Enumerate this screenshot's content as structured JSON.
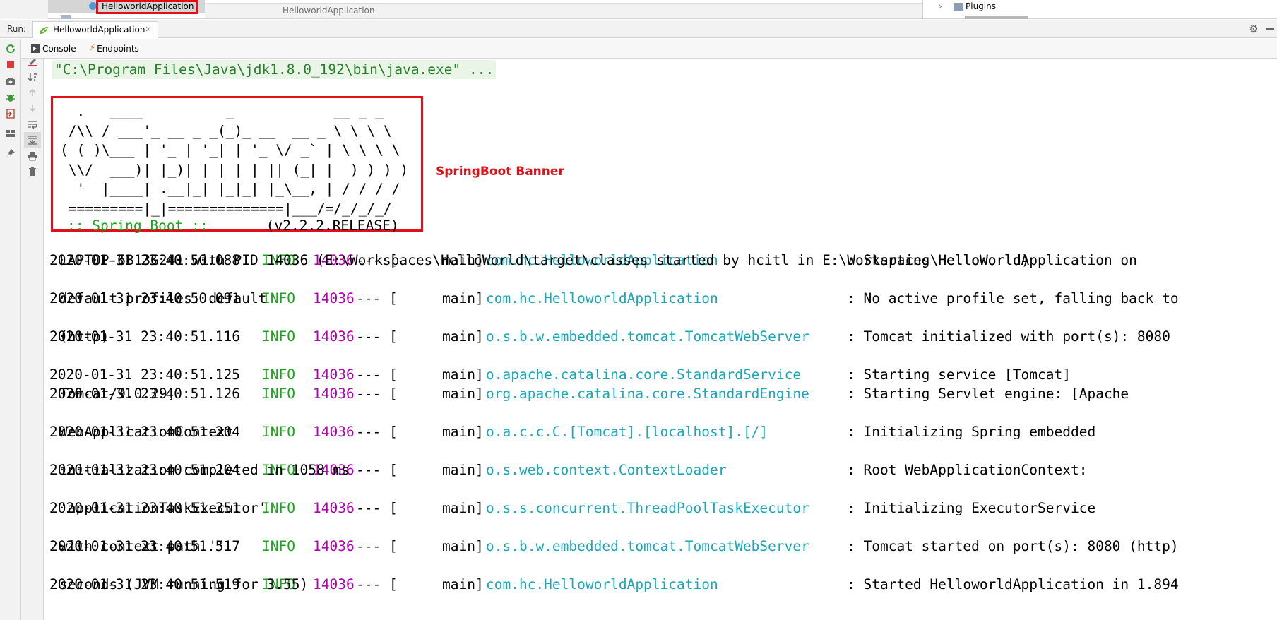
{
  "top_strip": {
    "tree_selected_item": "HelloworldApplication",
    "editor_tab_title": "HelloworldApplication",
    "right_panel_item": "Plugins"
  },
  "run_panel": {
    "run_label": "Run:",
    "run_tab": "HelloworldApplication",
    "console_tab": "Console",
    "endpoints_tab": "Endpoints"
  },
  "console": {
    "command_line": "\"C:\\Program Files\\Java\\jdk1.8.0_192\\bin\\java.exe\" ...",
    "banner_art": "  .   ____          _            __ _ _\n /\\\\ / ___'_ __ _ _(_)_ __  __ _ \\ \\ \\ \\\n( ( )\\___ | '_ | '_| | '_ \\/ _` | \\ \\ \\ \\\n \\\\/  ___)| |_)| | | | | || (_| |  ) ) ) )\n  '  |____| .__|_| |_|_| |_\\__, | / / / /\n =========|_|==============|___/=/_/_/_/",
    "banner_footer_label": ":: Spring Boot ::",
    "banner_version": "       (v2.2.2.RELEASE)",
    "banner_annotation": "SpringBoot Banner",
    "log_entries": [
      {
        "timestamp": "2020-01-31 23:40:50.088",
        "level": "INFO",
        "pid": "14036",
        "sep": "--- [",
        "thread": "main]",
        "logger": "com.hc.HelloworldApplication",
        "message": ": Starting HelloworldApplication on",
        "continuation": "LAPTOP-6B13G241 with PID 14036 (E:\\Workspaces\\HelloWorld\\target\\classes started by hcitl in E:\\Workspaces\\HelloWorld)"
      },
      {
        "timestamp": "2020-01-31 23:40:50.091",
        "level": "INFO",
        "pid": "14036",
        "sep": "--- [",
        "thread": "main]",
        "logger": "com.hc.HelloworldApplication",
        "message": ": No active profile set, falling back to",
        "continuation": "default profiles: default"
      },
      {
        "timestamp": "2020-01-31 23:40:51.116",
        "level": "INFO",
        "pid": "14036",
        "sep": "--- [",
        "thread": "main]",
        "logger": "o.s.b.w.embedded.tomcat.TomcatWebServer",
        "message": ": Tomcat initialized with port(s): 8080",
        "continuation": "(http)"
      },
      {
        "timestamp": "2020-01-31 23:40:51.125",
        "level": "INFO",
        "pid": "14036",
        "sep": "--- [",
        "thread": "main]",
        "logger": "o.apache.catalina.core.StandardService",
        "message": ": Starting service [Tomcat]",
        "continuation": ""
      },
      {
        "timestamp": "2020-01-31 23:40:51.126",
        "level": "INFO",
        "pid": "14036",
        "sep": "--- [",
        "thread": "main]",
        "logger": "org.apache.catalina.core.StandardEngine",
        "message": ": Starting Servlet engine: [Apache",
        "continuation": "Tomcat/9.0.29]"
      },
      {
        "timestamp": "2020-01-31 23:40:51.204",
        "level": "INFO",
        "pid": "14036",
        "sep": "--- [",
        "thread": "main]",
        "logger": "o.a.c.c.C.[Tomcat].[localhost].[/]",
        "message": ": Initializing Spring embedded",
        "continuation": "WebApplicationContext"
      },
      {
        "timestamp": "2020-01-31 23:40:51.204",
        "level": "INFO",
        "pid": "14036",
        "sep": "--- [",
        "thread": "main]",
        "logger": "o.s.web.context.ContextLoader",
        "message": ": Root WebApplicationContext:",
        "continuation": "initialization completed in 1058 ms"
      },
      {
        "timestamp": "2020-01-31 23:40:51.351",
        "level": "INFO",
        "pid": "14036",
        "sep": "--- [",
        "thread": "main]",
        "logger": "o.s.s.concurrent.ThreadPoolTaskExecutor",
        "message": ": Initializing ExecutorService",
        "continuation": "'applicationTaskExecutor'"
      },
      {
        "timestamp": "2020-01-31 23:40:51.517",
        "level": "INFO",
        "pid": "14036",
        "sep": "--- [",
        "thread": "main]",
        "logger": "o.s.b.w.embedded.tomcat.TomcatWebServer",
        "message": ": Tomcat started on port(s): 8080 (http)",
        "continuation": "with context path ''"
      },
      {
        "timestamp": "2020-01-31 23:40:51.519",
        "level": "INFO",
        "pid": "14036",
        "sep": "--- [",
        "thread": "main]",
        "logger": "com.hc.HelloworldApplication",
        "message": ": Started HelloworldApplication in 1.894",
        "continuation": "seconds (JVM running for 3.55)"
      }
    ]
  },
  "colors": {
    "accent_red": "#e0101b",
    "info_green": "#1aa61a",
    "pid_magenta": "#b000b0",
    "logger_cyan": "#18a8b8",
    "command_green": "#2a7d2a"
  },
  "icons": {
    "run_tab": "spring-run-icon",
    "console_tab": "console-icon",
    "endpoints_tab": "endpoints-icon",
    "settings": "gear-icon",
    "left_toolbar": [
      "rerun-icon",
      "stop-icon",
      "camera-icon",
      "debug-icon",
      "exit-icon",
      "layout-icon",
      "pin-icon"
    ],
    "console_toolbar": [
      "clear-edit-icon",
      "sort-icon",
      "up-arrow-icon",
      "down-arrow-icon",
      "soft-wrap-icon",
      "scroll-to-end-icon",
      "print-icon",
      "trash-icon"
    ]
  }
}
